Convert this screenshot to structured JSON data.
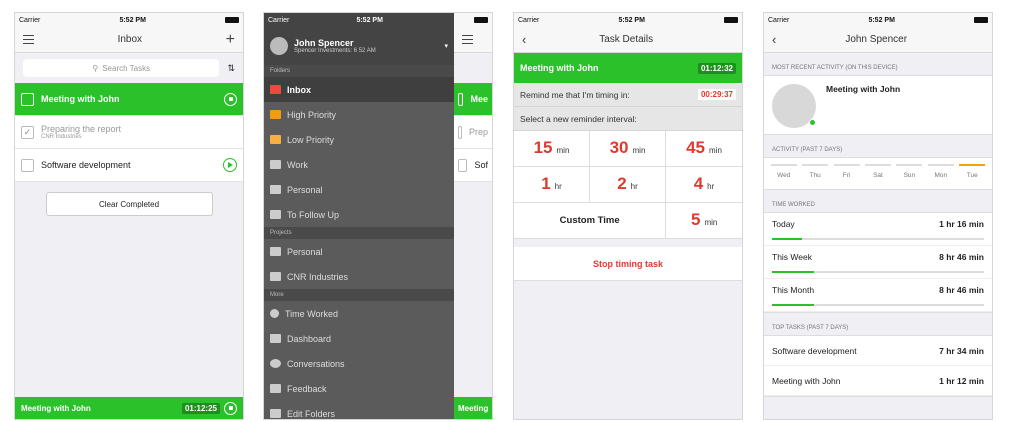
{
  "status": {
    "carrier": "Carrier",
    "time": "5:52 PM"
  },
  "inbox": {
    "title": "Inbox",
    "search_placeholder": "Search Tasks",
    "sort_icon": "sort-alpha-icon",
    "tasks": [
      {
        "name": "Meeting with John",
        "sub": "",
        "state": "active"
      },
      {
        "name": "Preparing the report",
        "sub": "CNR Industries",
        "state": "done"
      },
      {
        "name": "Software development",
        "sub": "",
        "state": "play"
      }
    ],
    "clear_label": "Clear Completed",
    "bottom_task": "Meeting with John",
    "bottom_timer": "01:12:25"
  },
  "menu": {
    "user": "John Spencer",
    "sub": "Spencer Investments: 6 52 AM",
    "folders_label": "Folders",
    "folders": [
      "Inbox",
      "High Priority",
      "Low Priority",
      "Work",
      "Personal",
      "To Follow Up"
    ],
    "projects_label": "Projects",
    "projects": [
      "Personal",
      "CNR Industries"
    ],
    "more_label": "More",
    "more": [
      "Time Worked",
      "Dashboard",
      "Conversations",
      "Feedback",
      "Edit Folders"
    ],
    "peek_task": "Mee",
    "peek_task2": "Prep",
    "peek_task3": "Sof",
    "peek_bottom": "Meeting"
  },
  "details": {
    "title": "Task Details",
    "task": "Meeting with John",
    "task_timer": "01:12:32",
    "remind_label": "Remind me that I'm timing in:",
    "remind_timer": "00:29:37",
    "interval_label": "Select a new reminder interval:",
    "intervals": [
      {
        "v": "15",
        "u": "min"
      },
      {
        "v": "30",
        "u": "min"
      },
      {
        "v": "45",
        "u": "min"
      },
      {
        "v": "1",
        "u": "hr"
      },
      {
        "v": "2",
        "u": "hr"
      },
      {
        "v": "4",
        "u": "hr"
      }
    ],
    "custom_label": "Custom Time",
    "custom_value": "5",
    "custom_unit": "min",
    "stop_label": "Stop timing task"
  },
  "profile": {
    "title": "John Spencer",
    "recent_header": "MOST RECENT ACTIVITY (ON THIS DEVICE)",
    "recent_task": "Meeting with John",
    "activity_header": "ACTIVITY (PAST 7 DAYS)",
    "days": [
      "Wed",
      "Thu",
      "Fri",
      "Sat",
      "Sun",
      "Mon",
      "Tue"
    ],
    "time_header": "TIME WORKED",
    "time_rows": [
      {
        "label": "Today",
        "value": "1 hr 16 min",
        "fraction": 0.14
      },
      {
        "label": "This Week",
        "value": "8 hr 46 min",
        "fraction": 0.2
      },
      {
        "label": "This Month",
        "value": "8 hr 46 min",
        "fraction": 0.2
      }
    ],
    "top_header": "TOP TASKS (PAST 7 DAYS)",
    "top_rows": [
      {
        "label": "Software development",
        "value": "7 hr 34 min"
      },
      {
        "label": "Meeting with John",
        "value": "1 hr 12 min"
      }
    ]
  }
}
